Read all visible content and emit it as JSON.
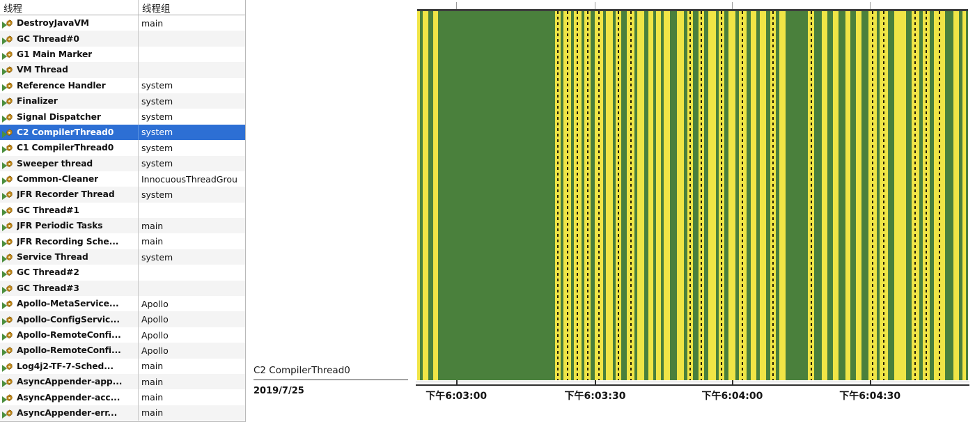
{
  "table": {
    "columns": [
      {
        "key": "thread",
        "label": "线程"
      },
      {
        "key": "group",
        "label": "线程组"
      }
    ],
    "icon": "thread-running-icon",
    "rows": [
      {
        "thread": "DestroyJavaVM",
        "group": "main"
      },
      {
        "thread": "GC Thread#0",
        "group": ""
      },
      {
        "thread": "G1 Main Marker",
        "group": ""
      },
      {
        "thread": "VM Thread",
        "group": ""
      },
      {
        "thread": "Reference Handler",
        "group": "system"
      },
      {
        "thread": "Finalizer",
        "group": "system"
      },
      {
        "thread": "Signal Dispatcher",
        "group": "system"
      },
      {
        "thread": "C2 CompilerThread0",
        "group": "system",
        "selected": true
      },
      {
        "thread": "C1 CompilerThread0",
        "group": "system"
      },
      {
        "thread": "Sweeper thread",
        "group": "system"
      },
      {
        "thread": "Common-Cleaner",
        "group": "InnocuousThreadGrou"
      },
      {
        "thread": "JFR Recorder Thread",
        "group": "system"
      },
      {
        "thread": "GC Thread#1",
        "group": ""
      },
      {
        "thread": "JFR Periodic Tasks",
        "group": "main"
      },
      {
        "thread": "JFR Recording Sche...",
        "group": "main"
      },
      {
        "thread": "Service Thread",
        "group": "system"
      },
      {
        "thread": "GC Thread#2",
        "group": ""
      },
      {
        "thread": "GC Thread#3",
        "group": ""
      },
      {
        "thread": "Apollo-MetaService...",
        "group": "Apollo"
      },
      {
        "thread": "Apollo-ConfigServic...",
        "group": "Apollo"
      },
      {
        "thread": "Apollo-RemoteConfi...",
        "group": "Apollo"
      },
      {
        "thread": "Apollo-RemoteConfi...",
        "group": "Apollo"
      },
      {
        "thread": "Log4j2-TF-7-Sched...",
        "group": "main"
      },
      {
        "thread": "AsyncAppender-app...",
        "group": "main"
      },
      {
        "thread": "AsyncAppender-acc...",
        "group": "main"
      },
      {
        "thread": "AsyncAppender-err...",
        "group": "main"
      }
    ],
    "selection_color": "#2d6fd4",
    "selection_text_color": "#ffffff"
  },
  "caption": {
    "thread_label": "C2 CompilerThread0",
    "date": "2019/7/25"
  },
  "chart_data": {
    "type": "bar",
    "title": "",
    "subtitle": "",
    "xlabel": "",
    "ylabel": "",
    "orientation": "horizontal-timeline",
    "description": "Thread state timeline for C2 CompilerThread0 — green = running, yellow = waiting/parked, dotted yellow = blocked segments",
    "grid": false,
    "legend_position": "none",
    "colors": {
      "running_green": "#4a803c",
      "waiting_yellow": "#f0e546",
      "dot_dark": "#241f07",
      "axis": "#2e2e2e",
      "plot_top_border": "#3c3c3c"
    },
    "x_axis": {
      "tick_labels": [
        "下午6:03:00",
        "下午6:03:30",
        "下午6:04:00",
        "下午6:04:30"
      ],
      "tick_positions_pct": [
        7.1,
        32.3,
        57.2,
        82.2
      ],
      "range_start": "下午6:02:55",
      "range_end": "下午6:05:00"
    },
    "top_ticks_pct": [
      7.1,
      32.3,
      57.2,
      82.2
    ],
    "bands": [
      {
        "start": 0.0,
        "width": 0.45,
        "state": "waiting",
        "dotted": false
      },
      {
        "start": 0.45,
        "width": 0.55,
        "state": "running",
        "dotted": false
      },
      {
        "start": 1.0,
        "width": 1.0,
        "state": "waiting",
        "dotted": false
      },
      {
        "start": 2.0,
        "width": 0.9,
        "state": "running",
        "dotted": false
      },
      {
        "start": 2.9,
        "width": 0.9,
        "state": "waiting",
        "dotted": false
      },
      {
        "start": 3.8,
        "width": 21.2,
        "state": "running",
        "dotted": false
      },
      {
        "start": 25.0,
        "width": 1.0,
        "state": "waiting",
        "dotted": true
      },
      {
        "start": 26.0,
        "width": 0.6,
        "state": "running",
        "dotted": false
      },
      {
        "start": 26.6,
        "width": 1.3,
        "state": "waiting",
        "dotted": true
      },
      {
        "start": 27.9,
        "width": 0.5,
        "state": "running",
        "dotted": false
      },
      {
        "start": 28.4,
        "width": 1.4,
        "state": "waiting",
        "dotted": true
      },
      {
        "start": 29.8,
        "width": 0.6,
        "state": "running",
        "dotted": false
      },
      {
        "start": 30.4,
        "width": 1.1,
        "state": "waiting",
        "dotted": true
      },
      {
        "start": 31.5,
        "width": 0.7,
        "state": "running",
        "dotted": false
      },
      {
        "start": 32.2,
        "width": 1.5,
        "state": "waiting",
        "dotted": true
      },
      {
        "start": 33.7,
        "width": 0.6,
        "state": "running",
        "dotted": false
      },
      {
        "start": 34.3,
        "width": 1.2,
        "state": "waiting",
        "dotted": false
      },
      {
        "start": 35.5,
        "width": 0.5,
        "state": "running",
        "dotted": false
      },
      {
        "start": 36.0,
        "width": 1.1,
        "state": "waiting",
        "dotted": true
      },
      {
        "start": 37.1,
        "width": 1.0,
        "state": "running",
        "dotted": false
      },
      {
        "start": 38.1,
        "width": 1.4,
        "state": "waiting",
        "dotted": true
      },
      {
        "start": 39.5,
        "width": 0.5,
        "state": "running",
        "dotted": false
      },
      {
        "start": 40.0,
        "width": 1.2,
        "state": "waiting",
        "dotted": false
      },
      {
        "start": 41.2,
        "width": 0.8,
        "state": "running",
        "dotted": false
      },
      {
        "start": 42.0,
        "width": 0.8,
        "state": "waiting",
        "dotted": false
      },
      {
        "start": 42.8,
        "width": 0.5,
        "state": "running",
        "dotted": false
      },
      {
        "start": 43.3,
        "width": 0.9,
        "state": "waiting",
        "dotted": false
      },
      {
        "start": 44.2,
        "width": 0.6,
        "state": "running",
        "dotted": false
      },
      {
        "start": 44.8,
        "width": 1.1,
        "state": "waiting",
        "dotted": false
      },
      {
        "start": 45.9,
        "width": 1.2,
        "state": "running",
        "dotted": false
      },
      {
        "start": 47.1,
        "width": 1.3,
        "state": "waiting",
        "dotted": false
      },
      {
        "start": 48.4,
        "width": 0.6,
        "state": "running",
        "dotted": false
      },
      {
        "start": 49.0,
        "width": 1.1,
        "state": "waiting",
        "dotted": true
      },
      {
        "start": 50.1,
        "width": 1.0,
        "state": "running",
        "dotted": false
      },
      {
        "start": 51.1,
        "width": 1.0,
        "state": "waiting",
        "dotted": true
      },
      {
        "start": 52.1,
        "width": 0.7,
        "state": "running",
        "dotted": false
      },
      {
        "start": 52.8,
        "width": 1.4,
        "state": "waiting",
        "dotted": false
      },
      {
        "start": 54.2,
        "width": 0.6,
        "state": "running",
        "dotted": false
      },
      {
        "start": 54.8,
        "width": 1.0,
        "state": "waiting",
        "dotted": true
      },
      {
        "start": 55.8,
        "width": 0.7,
        "state": "running",
        "dotted": false
      },
      {
        "start": 56.5,
        "width": 1.3,
        "state": "waiting",
        "dotted": false
      },
      {
        "start": 57.8,
        "width": 0.6,
        "state": "running",
        "dotted": false
      },
      {
        "start": 58.4,
        "width": 1.4,
        "state": "waiting",
        "dotted": true
      },
      {
        "start": 59.8,
        "width": 0.8,
        "state": "running",
        "dotted": false
      },
      {
        "start": 60.6,
        "width": 1.0,
        "state": "waiting",
        "dotted": false
      },
      {
        "start": 61.6,
        "width": 0.6,
        "state": "running",
        "dotted": false
      },
      {
        "start": 62.2,
        "width": 1.2,
        "state": "waiting",
        "dotted": false
      },
      {
        "start": 63.4,
        "width": 0.7,
        "state": "running",
        "dotted": false
      },
      {
        "start": 64.1,
        "width": 1.0,
        "state": "waiting",
        "dotted": true
      },
      {
        "start": 65.1,
        "width": 0.7,
        "state": "running",
        "dotted": false
      },
      {
        "start": 65.8,
        "width": 1.1,
        "state": "waiting",
        "dotted": false
      },
      {
        "start": 66.9,
        "width": 4.0,
        "state": "running",
        "dotted": false
      },
      {
        "start": 70.9,
        "width": 1.2,
        "state": "waiting",
        "dotted": true
      },
      {
        "start": 72.1,
        "width": 1.3,
        "state": "running",
        "dotted": false
      },
      {
        "start": 73.4,
        "width": 1.0,
        "state": "waiting",
        "dotted": false
      },
      {
        "start": 74.4,
        "width": 1.1,
        "state": "running",
        "dotted": false
      },
      {
        "start": 75.5,
        "width": 1.0,
        "state": "waiting",
        "dotted": false
      },
      {
        "start": 76.5,
        "width": 1.2,
        "state": "running",
        "dotted": false
      },
      {
        "start": 77.7,
        "width": 0.9,
        "state": "waiting",
        "dotted": false
      },
      {
        "start": 78.6,
        "width": 1.1,
        "state": "running",
        "dotted": false
      },
      {
        "start": 79.7,
        "width": 1.0,
        "state": "waiting",
        "dotted": false
      },
      {
        "start": 80.7,
        "width": 1.2,
        "state": "running",
        "dotted": false
      },
      {
        "start": 81.9,
        "width": 1.5,
        "state": "waiting",
        "dotted": true
      },
      {
        "start": 83.4,
        "width": 0.6,
        "state": "running",
        "dotted": false
      },
      {
        "start": 84.0,
        "width": 1.5,
        "state": "waiting",
        "dotted": true
      },
      {
        "start": 85.5,
        "width": 1.1,
        "state": "running",
        "dotted": false
      },
      {
        "start": 86.6,
        "width": 2.2,
        "state": "waiting",
        "dotted": false
      },
      {
        "start": 88.8,
        "width": 0.9,
        "state": "running",
        "dotted": false
      },
      {
        "start": 89.7,
        "width": 1.4,
        "state": "waiting",
        "dotted": true
      },
      {
        "start": 91.1,
        "width": 0.7,
        "state": "running",
        "dotted": false
      },
      {
        "start": 91.8,
        "width": 1.3,
        "state": "waiting",
        "dotted": true
      },
      {
        "start": 93.1,
        "width": 0.7,
        "state": "running",
        "dotted": false
      },
      {
        "start": 93.8,
        "width": 2.0,
        "state": "waiting",
        "dotted": true
      },
      {
        "start": 95.8,
        "width": 1.6,
        "state": "running",
        "dotted": false
      },
      {
        "start": 97.4,
        "width": 0.9,
        "state": "waiting",
        "dotted": false
      },
      {
        "start": 98.3,
        "width": 0.7,
        "state": "running",
        "dotted": false
      },
      {
        "start": 99.0,
        "width": 0.6,
        "state": "waiting",
        "dotted": false
      },
      {
        "start": 99.6,
        "width": 0.4,
        "state": "running",
        "dotted": false
      }
    ]
  }
}
